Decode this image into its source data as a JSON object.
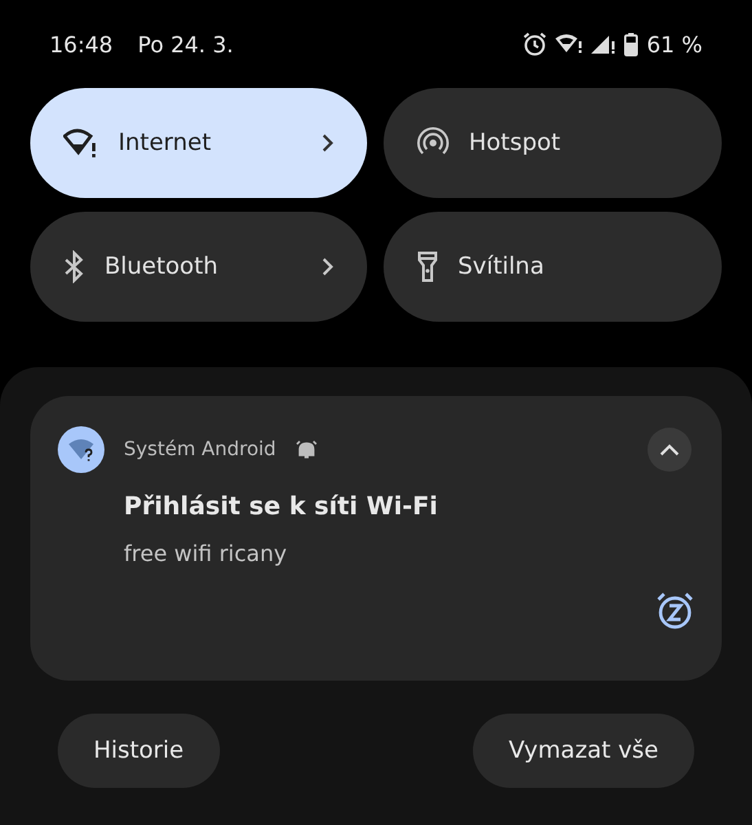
{
  "status_bar": {
    "time": "16:48",
    "date": "Po 24. 3.",
    "battery": "61 %"
  },
  "tiles": [
    {
      "kind": "internet",
      "label": "Internet",
      "on": true,
      "has_details": true
    },
    {
      "kind": "hotspot",
      "label": "Hotspot",
      "on": false,
      "has_details": false
    },
    {
      "kind": "bluetooth",
      "label": "Bluetooth",
      "on": false,
      "has_details": true
    },
    {
      "kind": "flashlight",
      "label": "Svítilna",
      "on": false,
      "has_details": false
    }
  ],
  "notification": {
    "app": "Systém Android",
    "title": "Přihlásit se k síti Wi-Fi",
    "text": "free wifi ricany",
    "expanded": true
  },
  "buttons": [
    "Historie",
    "Vymazat vše"
  ]
}
